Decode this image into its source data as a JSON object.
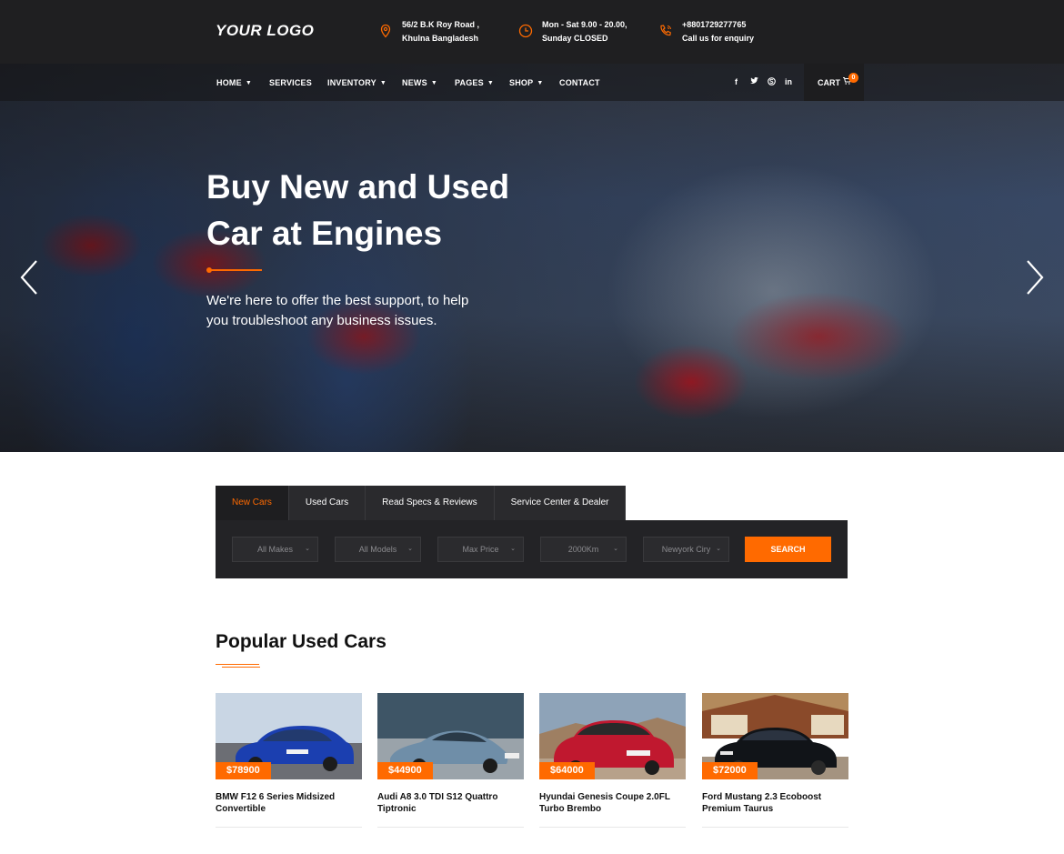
{
  "header": {
    "logo": "YOUR LOGO",
    "address_line1": "56/2 B.K Roy Road ,",
    "address_line2": "Khulna Bangladesh",
    "hours_line1": "Mon - Sat 9.00 - 20.00,",
    "hours_line2": "Sunday CLOSED",
    "phone_line1": "+8801729277765",
    "phone_line2": "Call us for enquiry",
    "icons": [
      "map-pin-icon",
      "clock-icon",
      "phone-icon"
    ],
    "accent": "#ff6a00"
  },
  "nav": {
    "items": [
      {
        "label": "HOME",
        "dropdown": true
      },
      {
        "label": "SERVICES",
        "dropdown": false
      },
      {
        "label": "INVENTORY",
        "dropdown": true
      },
      {
        "label": "NEWS",
        "dropdown": true
      },
      {
        "label": "PAGES",
        "dropdown": true
      },
      {
        "label": "SHOP",
        "dropdown": true
      },
      {
        "label": "CONTACT",
        "dropdown": false
      }
    ],
    "social": [
      "f",
      "t",
      "s",
      "in"
    ],
    "social_icons": [
      "facebook-icon",
      "twitter-icon",
      "skype-icon",
      "linkedin-icon"
    ],
    "cart_label": "CART",
    "cart_count": "0"
  },
  "hero": {
    "title_line1": "Buy New and Used",
    "title_line2": "Car at Engines",
    "subtitle_line1": "We're here to offer the best support, to help",
    "subtitle_line2": "you troubleshoot any business issues."
  },
  "search": {
    "tabs": [
      "New Cars",
      "Used Cars",
      "Read Specs & Reviews",
      "Service Center & Dealer"
    ],
    "active_tab": "New Cars",
    "selects": [
      "All Makes",
      "All Models",
      "Max Price",
      "2000Km",
      "Newyork Ciry"
    ],
    "button": "SEARCH"
  },
  "popular": {
    "title": "Popular Used Cars",
    "cars": [
      {
        "price": "$78900",
        "name_line1": "BMW F12 6 Series Midsized",
        "name_line2": "Convertible",
        "color": "#1b3fb0"
      },
      {
        "price": "$44900",
        "name_line1": "Audi A8 3.0 TDI S12 Quattro",
        "name_line2": "Tiptronic",
        "color": "#6f8ea8"
      },
      {
        "price": "$64000",
        "name_line1": "Hyundai Genesis Coupe 2.0FL",
        "name_line2": "Turbo Brembo",
        "color": "#c0182f"
      },
      {
        "price": "$72000",
        "name_line1": "Ford Mustang 2.3 Ecoboost",
        "name_line2": "Premium Taurus",
        "color": "#111418"
      }
    ]
  }
}
